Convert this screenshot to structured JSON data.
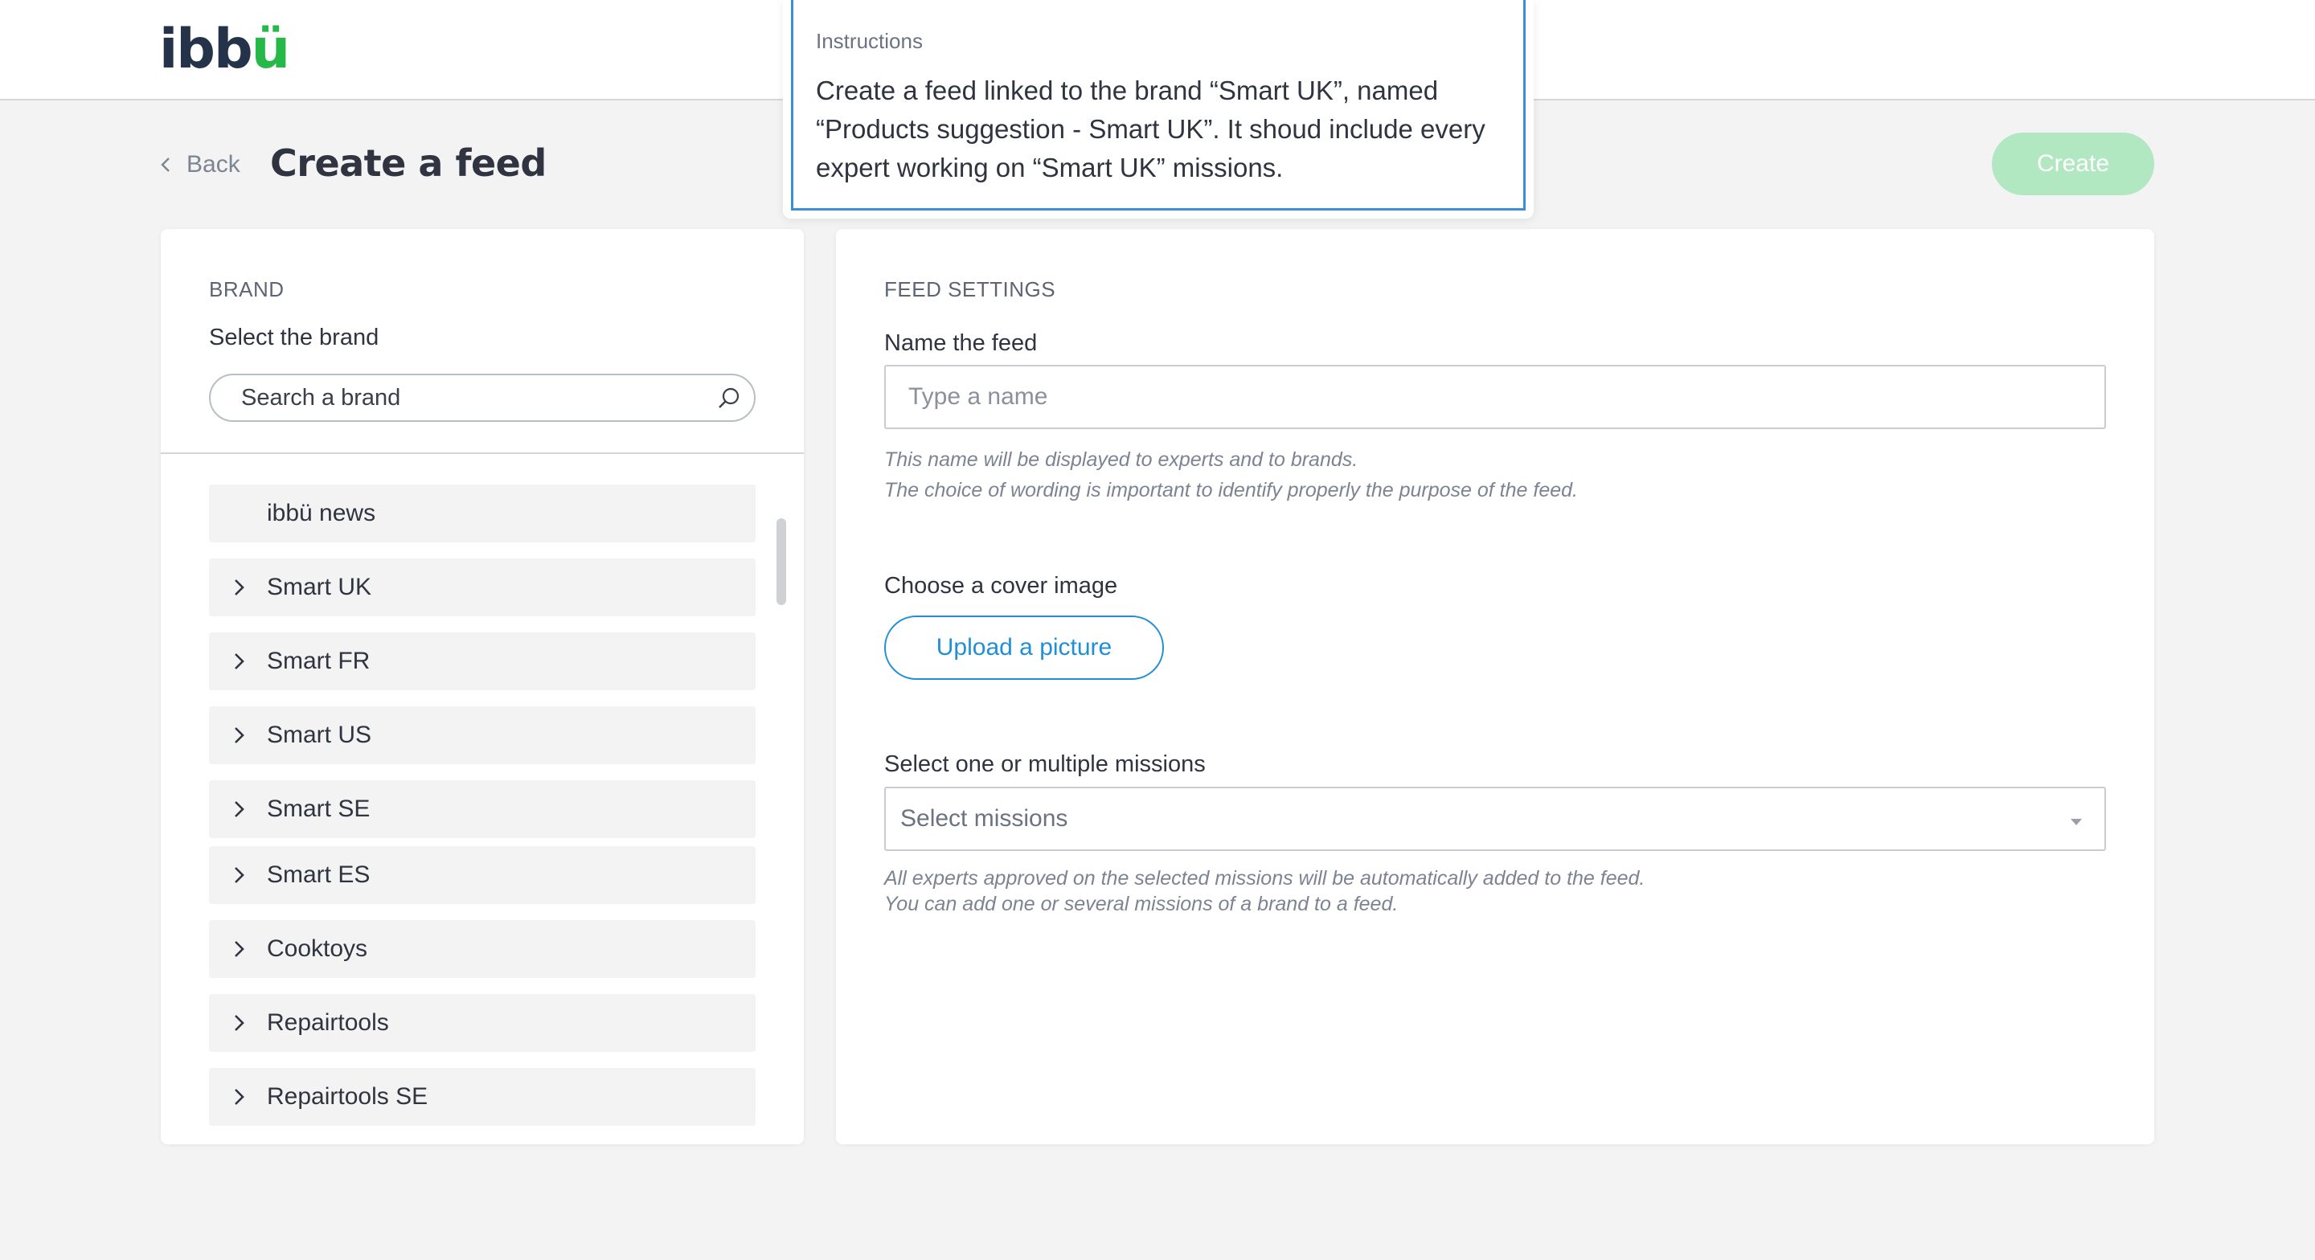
{
  "app": {
    "logo_main": "ibb",
    "logo_accent": "ü"
  },
  "header": {
    "back_label": "Back",
    "title": "Create a feed",
    "create_label": "Create"
  },
  "instructions": {
    "label": "Instructions",
    "text": "Create a feed linked to the brand “Smart UK”, named “Products suggestion - Smart UK”. It shoud include every expert working on “Smart UK” missions."
  },
  "brand_panel": {
    "section_label": "BRAND",
    "select_label": "Select the brand",
    "search_placeholder": "Search a brand",
    "items": [
      {
        "label": "ibbü news",
        "expandable": false
      },
      {
        "label": "Smart UK",
        "expandable": true
      },
      {
        "label": "Smart FR",
        "expandable": true
      },
      {
        "label": "Smart US",
        "expandable": true
      },
      {
        "label": "Smart SE",
        "expandable": true
      },
      {
        "label": "Smart ES",
        "expandable": true
      },
      {
        "label": "Cooktoys",
        "expandable": true
      },
      {
        "label": "Repairtools",
        "expandable": true
      },
      {
        "label": "Repairtools SE",
        "expandable": true
      }
    ]
  },
  "settings_panel": {
    "section_label": "FEED SETTINGS",
    "name_label": "Name the feed",
    "name_placeholder": "Type a name",
    "name_hint_1": "This name will be displayed to experts and to brands.",
    "name_hint_2": "The choice of wording is important to identify properly the purpose of the feed.",
    "cover_label": "Choose a cover image",
    "upload_label": "Upload a picture",
    "missions_label": "Select one or multiple missions",
    "missions_placeholder": "Select missions",
    "missions_hint_1": "All experts approved on the selected missions will be automatically added to the feed.",
    "missions_hint_2": "You can add one or several missions of a brand to a feed."
  },
  "colors": {
    "brand_green": "#27b84a",
    "create_button": "#b2e8c1",
    "link_blue": "#1f8fd8",
    "focus_blue": "#3b8fd6"
  }
}
